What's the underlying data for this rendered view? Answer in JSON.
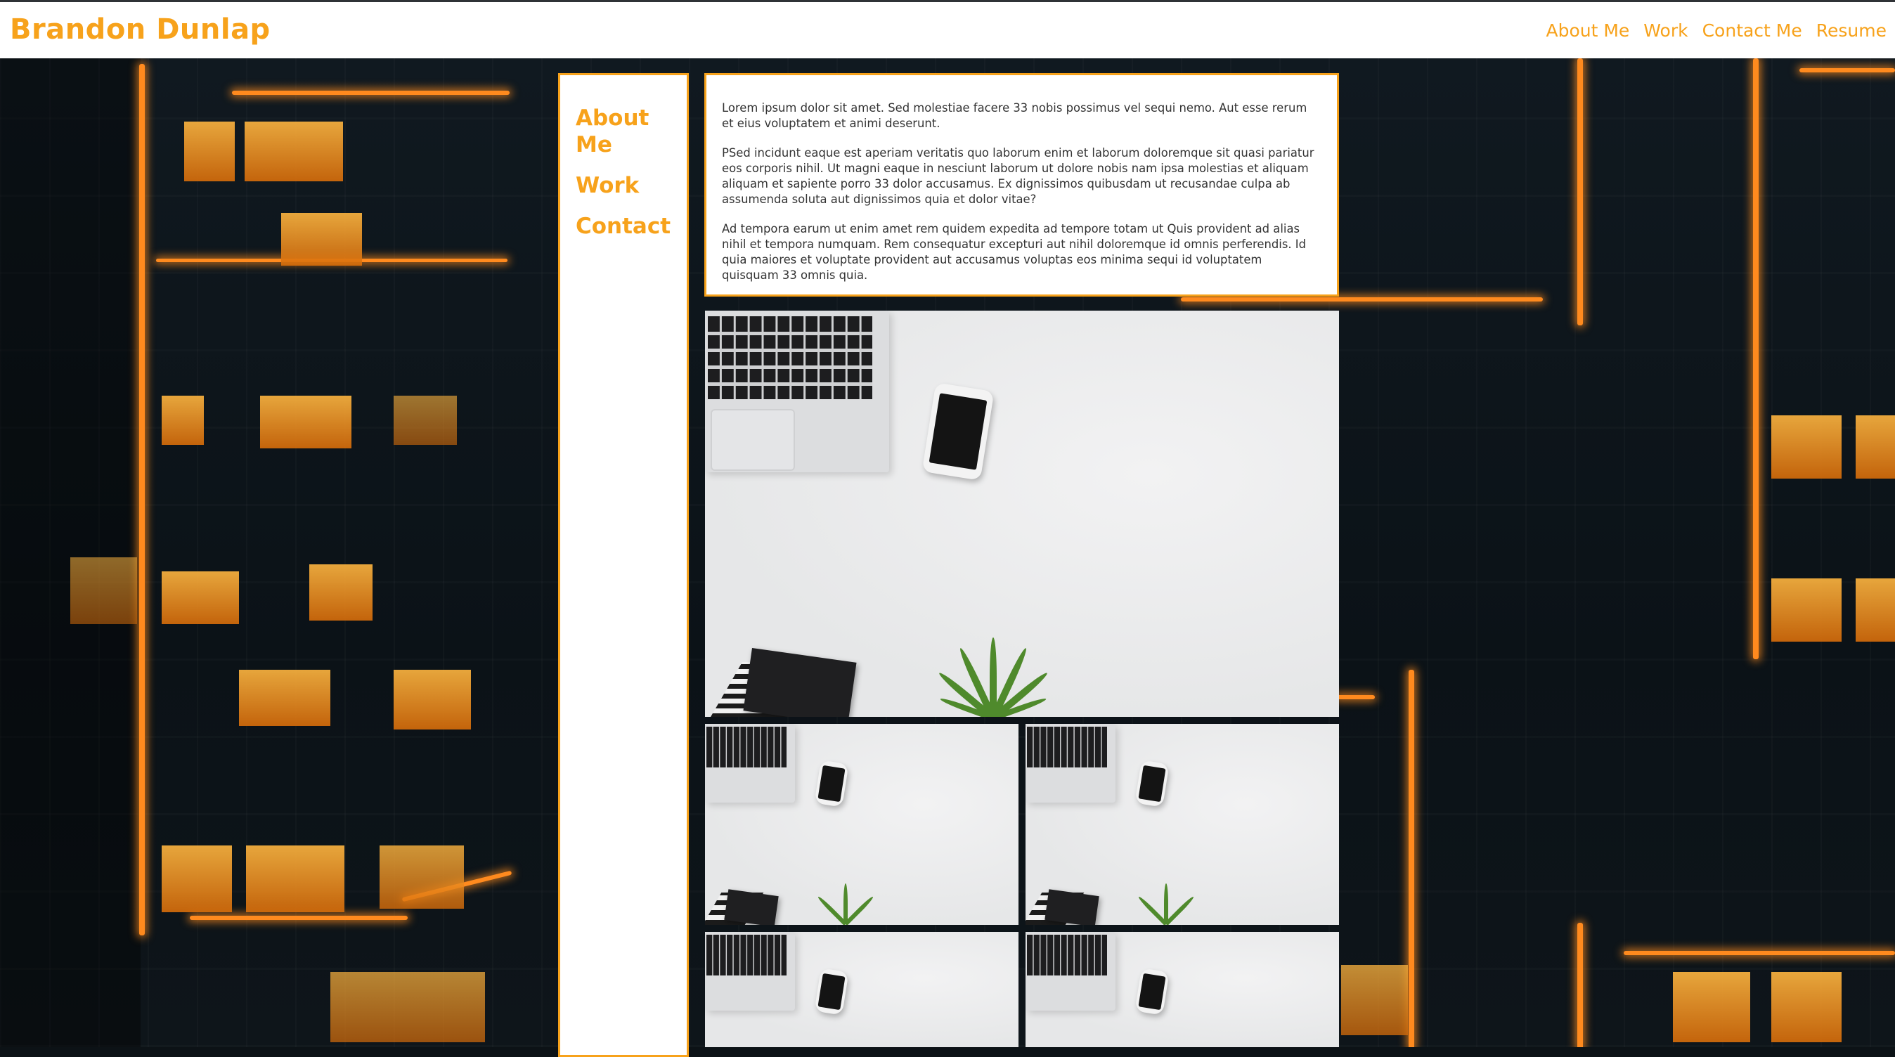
{
  "header": {
    "brand": "Brandon Dunlap",
    "nav": [
      "About Me",
      "Work",
      "Contact Me",
      "Resume"
    ]
  },
  "sidebar": {
    "items": [
      "About Me",
      "Work",
      "Contact"
    ]
  },
  "about": {
    "paragraphs": [
      "Lorem ipsum dolor sit amet. Sed molestiae facere 33 nobis possimus vel sequi nemo. Aut esse rerum et eius voluptatem et animi deserunt.",
      "PSed incidunt eaque est aperiam veritatis quo laborum enim et laborum doloremque sit quasi pariatur eos corporis nihil. Ut magni eaque in nesciunt laborum ut dolore nobis nam ipsa molestias et aliquam aliquam et sapiente porro 33 dolor accusamus. Ex dignissimos quibusdam ut recusandae culpa ab assumenda soluta aut dignissimos quia et dolor vitae?",
      "Ad tempora earum ut enim amet rem quidem expedita ad tempore totam ut Quis provident ad alias nihil et tempora numquam. Rem consequatur excepturi aut nihil doloremque id omnis perferendis. Id quia maiores et voluptate provident aut accusamus voluptas eos minima sequi id voluptatem quisquam 33 omnis quia."
    ]
  },
  "colors": {
    "accent": "#f7a21b",
    "card": "#ffffff",
    "background": "#0c1216"
  },
  "icons": {
    "work_images": "desk-workspace-photo",
    "background": "night-city-buildings-photo"
  }
}
